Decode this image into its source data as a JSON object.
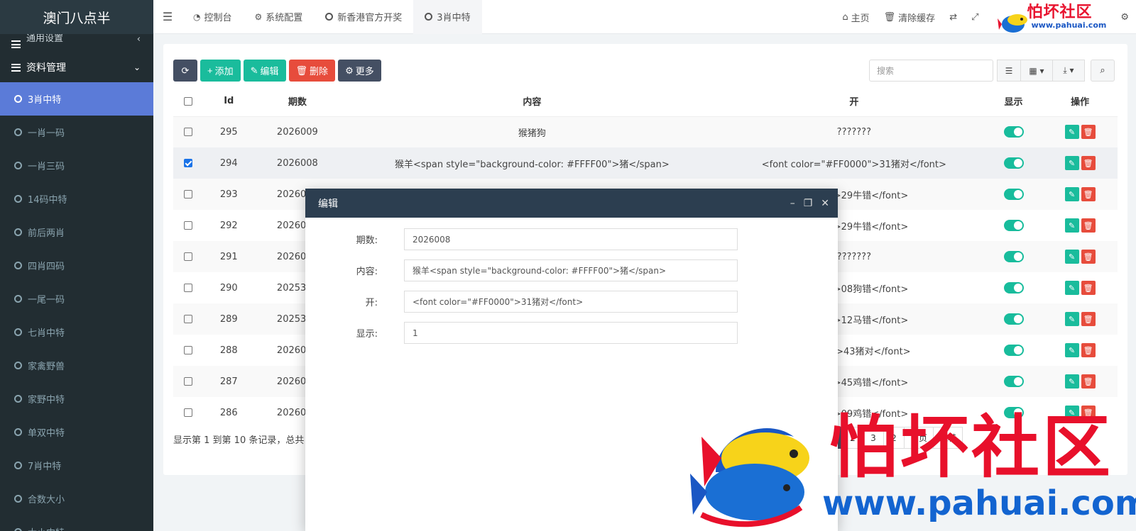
{
  "sidebar": {
    "brand": "澳门八点半",
    "partial_item": "通用设置",
    "section": "资料管理",
    "items": [
      {
        "label": "3肖中特",
        "active": true
      },
      {
        "label": "一肖一码",
        "active": false
      },
      {
        "label": "一肖三码",
        "active": false
      },
      {
        "label": "14码中特",
        "active": false
      },
      {
        "label": "前后两肖",
        "active": false
      },
      {
        "label": "四肖四码",
        "active": false
      },
      {
        "label": "一尾一码",
        "active": false
      },
      {
        "label": "七肖中特",
        "active": false
      },
      {
        "label": "家禽野兽",
        "active": false
      },
      {
        "label": "家野中特",
        "active": false
      },
      {
        "label": "单双中特",
        "active": false
      },
      {
        "label": "7肖中特",
        "active": false
      },
      {
        "label": "合数大小",
        "active": false
      },
      {
        "label": "大小中特",
        "active": false
      }
    ]
  },
  "topbar": {
    "tabs": [
      {
        "label": "控制台",
        "icon": "dashboard-icon"
      },
      {
        "label": "系统配置",
        "icon": "gear-icon"
      },
      {
        "label": "新香港官方开奖",
        "icon": "circle-icon"
      },
      {
        "label": "3肖中特",
        "icon": "circle-icon"
      }
    ],
    "home": "主页",
    "clear_cache": "清除缓存",
    "logo_cn": "怕坏社区",
    "logo_en": "www.pahuai.com"
  },
  "toolbar": {
    "add": "添加",
    "edit": "编辑",
    "delete": "删除",
    "more": "更多",
    "search_placeholder": "搜索"
  },
  "table": {
    "headers": {
      "id": "Id",
      "issue": "期数",
      "content": "内容",
      "open": "开",
      "show": "显示",
      "ops": "操作"
    },
    "rows": [
      {
        "id": "295",
        "issue": "2026009",
        "content": "猴猪狗",
        "open": "???????",
        "checked": false
      },
      {
        "id": "294",
        "issue": "2026008",
        "content": "猴羊<span style=\"background-color: #FFFF00\">猪</span>",
        "open": "<font color=\"#FF0000\">31猪对</font>",
        "checked": true
      },
      {
        "id": "293",
        "issue": "2026007",
        "content": "",
        "open": "00000\">29牛错</font>",
        "checked": false
      },
      {
        "id": "292",
        "issue": "2026006",
        "content": "",
        "open": "00000\">29牛错</font>",
        "checked": false
      },
      {
        "id": "291",
        "issue": "2026005",
        "content": "",
        "open": "???????",
        "checked": false
      },
      {
        "id": "290",
        "issue": "2025365",
        "content": "",
        "open": "00000\">08狗错</font>",
        "checked": false
      },
      {
        "id": "289",
        "issue": "2025364",
        "content": "",
        "open": "00000\">12马错</font>",
        "checked": false
      },
      {
        "id": "288",
        "issue": "2026004",
        "content": "",
        "open": "FF0000\">43猪对</font>",
        "checked": false
      },
      {
        "id": "287",
        "issue": "2026003",
        "content": "",
        "open": "00000\">45鸡错</font>",
        "checked": false
      },
      {
        "id": "286",
        "issue": "2026002",
        "content": "",
        "open": "00000\">09鸡错</font>",
        "checked": false
      }
    ]
  },
  "footer": {
    "info": "显示第 1 到第 10 条记录，总共",
    "pages": [
      "1",
      "2",
      "3",
      "2",
      "下页",
      "跳转"
    ]
  },
  "modal": {
    "title": "编辑",
    "fields": [
      {
        "label": "期数:",
        "value": "2026008"
      },
      {
        "label": "内容:",
        "value": "猴羊<span style=\"background-color: #FFFF00\">猪</span>"
      },
      {
        "label": "开:",
        "value": "<font color=\"#FF0000\">31猪对</font>"
      },
      {
        "label": "显示:",
        "value": "1"
      }
    ]
  },
  "watermark": {
    "cn": "怕坏社区",
    "en": "www.pahuai.com"
  },
  "colors": {
    "sidebar_bg": "#222d32",
    "active_item": "#5b7bd8",
    "green": "#1abc9c",
    "red": "#e74c3c",
    "modal_head": "#2c3e50",
    "watermark_red": "#e8102b",
    "watermark_blue": "#1364d0"
  }
}
